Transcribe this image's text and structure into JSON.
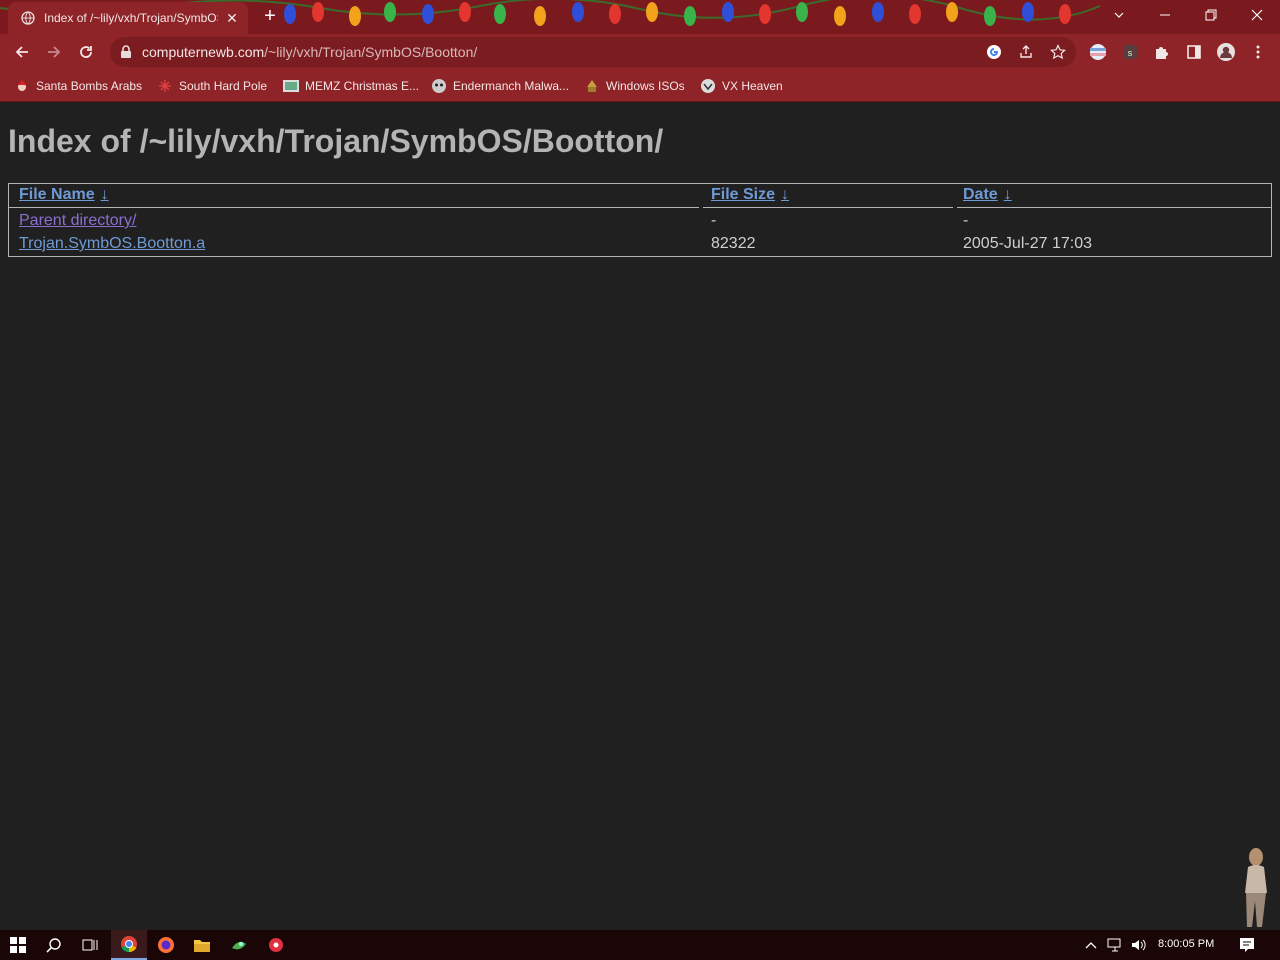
{
  "tab": {
    "title": "Index of /~lily/vxh/Trojan/SymbOS/Bootton/",
    "close": "✕",
    "new_tab": "+"
  },
  "window": {
    "min": "—",
    "restore": "❐",
    "close": "✕",
    "tab_search": "⌄"
  },
  "address": {
    "domain": "computernewb.com",
    "path": "/~lily/vxh/Trojan/SymbOS/Bootton/"
  },
  "bookmarks": [
    {
      "label": "Santa Bombs Arabs",
      "icon": "santa-icon"
    },
    {
      "label": "South Hard Pole",
      "icon": "snowflake-icon"
    },
    {
      "label": "MEMZ Christmas E...",
      "icon": "memz-icon"
    },
    {
      "label": "Endermanch Malwa...",
      "icon": "endermanch-icon"
    },
    {
      "label": "Windows ISOs",
      "icon": "windows-iso-icon"
    },
    {
      "label": "VX Heaven",
      "icon": "vx-heaven-icon"
    }
  ],
  "page": {
    "heading": "Index of /~lily/vxh/Trojan/SymbOS/Bootton/",
    "columns": [
      {
        "label": "File Name",
        "sort": "↓"
      },
      {
        "label": "File Size",
        "sort": "↓"
      },
      {
        "label": "Date",
        "sort": "↓"
      }
    ],
    "rows": [
      {
        "name": "Parent directory/",
        "size": "-",
        "date": "-"
      },
      {
        "name": "Trojan.SymbOS.Bootton.a",
        "size": "82322",
        "date": "2005-Jul-27 17:03"
      }
    ]
  },
  "taskbar": {
    "clock": "8:00:05 PM",
    "apps": [
      "start-icon",
      "search-icon",
      "task-view-icon",
      "chrome-icon",
      "firefox-icon",
      "file-explorer-icon",
      "app-icon",
      "app-icon-2"
    ]
  },
  "colors": {
    "titlebar": "#7a1a1f",
    "toolbar": "#8e2328",
    "page_bg": "#202020",
    "link": "#6f9ad6",
    "visited": "#8a6fd0"
  }
}
